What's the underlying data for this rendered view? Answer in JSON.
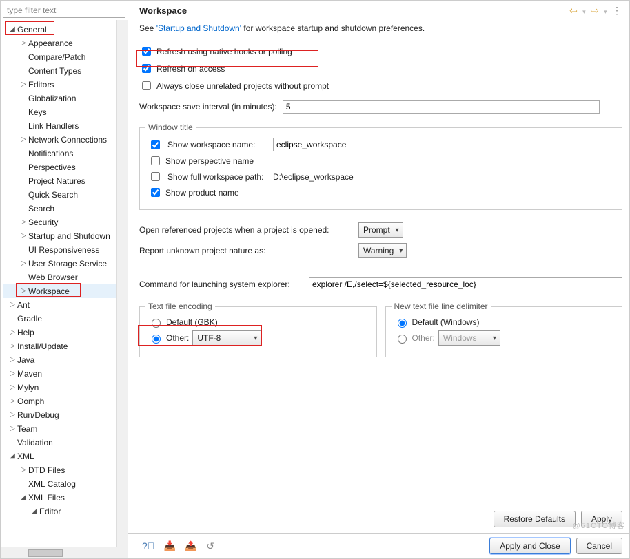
{
  "filter_placeholder": "type filter text",
  "tree": {
    "general": "General",
    "general_children": [
      "Appearance",
      "Compare/Patch",
      "Content Types",
      "Editors",
      "Globalization",
      "Keys",
      "Link Handlers",
      "Network Connections",
      "Notifications",
      "Perspectives",
      "Project Natures",
      "Quick Search",
      "Search",
      "Security",
      "Startup and Shutdown",
      "UI Responsiveness",
      "User Storage Service",
      "Web Browser",
      "Workspace"
    ],
    "arrows": {
      "Appearance": true,
      "Editors": true,
      "Network Connections": true,
      "Security": true,
      "Startup and Shutdown": true,
      "User Storage Service": true,
      "Workspace": true
    },
    "roots": [
      "Ant",
      "Gradle",
      "Help",
      "Install/Update",
      "Java",
      "Maven",
      "Mylyn",
      "Oomph",
      "Run/Debug",
      "Team",
      "Validation"
    ],
    "root_arrows": {
      "Ant": true,
      "Help": true,
      "Install/Update": true,
      "Java": true,
      "Maven": true,
      "Mylyn": true,
      "Oomph": true,
      "Run/Debug": true,
      "Team": true
    },
    "xml": "XML",
    "xml_children": [
      "DTD Files",
      "XML Catalog"
    ],
    "xml_arrows": {
      "DTD Files": true
    },
    "xml_files": "XML Files",
    "xml_files_child": "Editor"
  },
  "page_title": "Workspace",
  "see_prefix": "See ",
  "see_link": "'Startup and Shutdown'",
  "see_suffix": " for workspace startup and shutdown preferences.",
  "cb_refresh_hooks": "Refresh using native hooks or polling",
  "cb_refresh_access": "Refresh on access",
  "cb_close_unrelated": "Always close unrelated projects without prompt",
  "save_interval_label": "Workspace save interval (in minutes):",
  "save_interval_value": "5",
  "window_title_legend": "Window title",
  "wt_show_ws_name": "Show workspace name:",
  "wt_ws_name_value": "eclipse_workspace",
  "wt_show_persp": "Show perspective name",
  "wt_show_full_path": "Show full workspace path:",
  "wt_full_path_value": "D:\\eclipse_workspace",
  "wt_show_product": "Show product name",
  "open_ref_label": "Open referenced projects when a project is opened:",
  "open_ref_value": "Prompt",
  "report_nature_label": "Report unknown project nature as:",
  "report_nature_value": "Warning",
  "explorer_label": "Command for launching system explorer:",
  "explorer_value": "explorer /E,/select=${selected_resource_loc}",
  "encoding_legend": "Text file encoding",
  "encoding_default": "Default (GBK)",
  "encoding_other": "Other:",
  "encoding_other_value": "UTF-8",
  "delim_legend": "New text file line delimiter",
  "delim_default": "Default (Windows)",
  "delim_other": "Other:",
  "delim_other_value": "Windows",
  "btn_restore": "Restore Defaults",
  "btn_apply": "Apply",
  "btn_apply_close": "Apply and Close",
  "btn_cancel": "Cancel",
  "watermark": "@51CTO博客"
}
